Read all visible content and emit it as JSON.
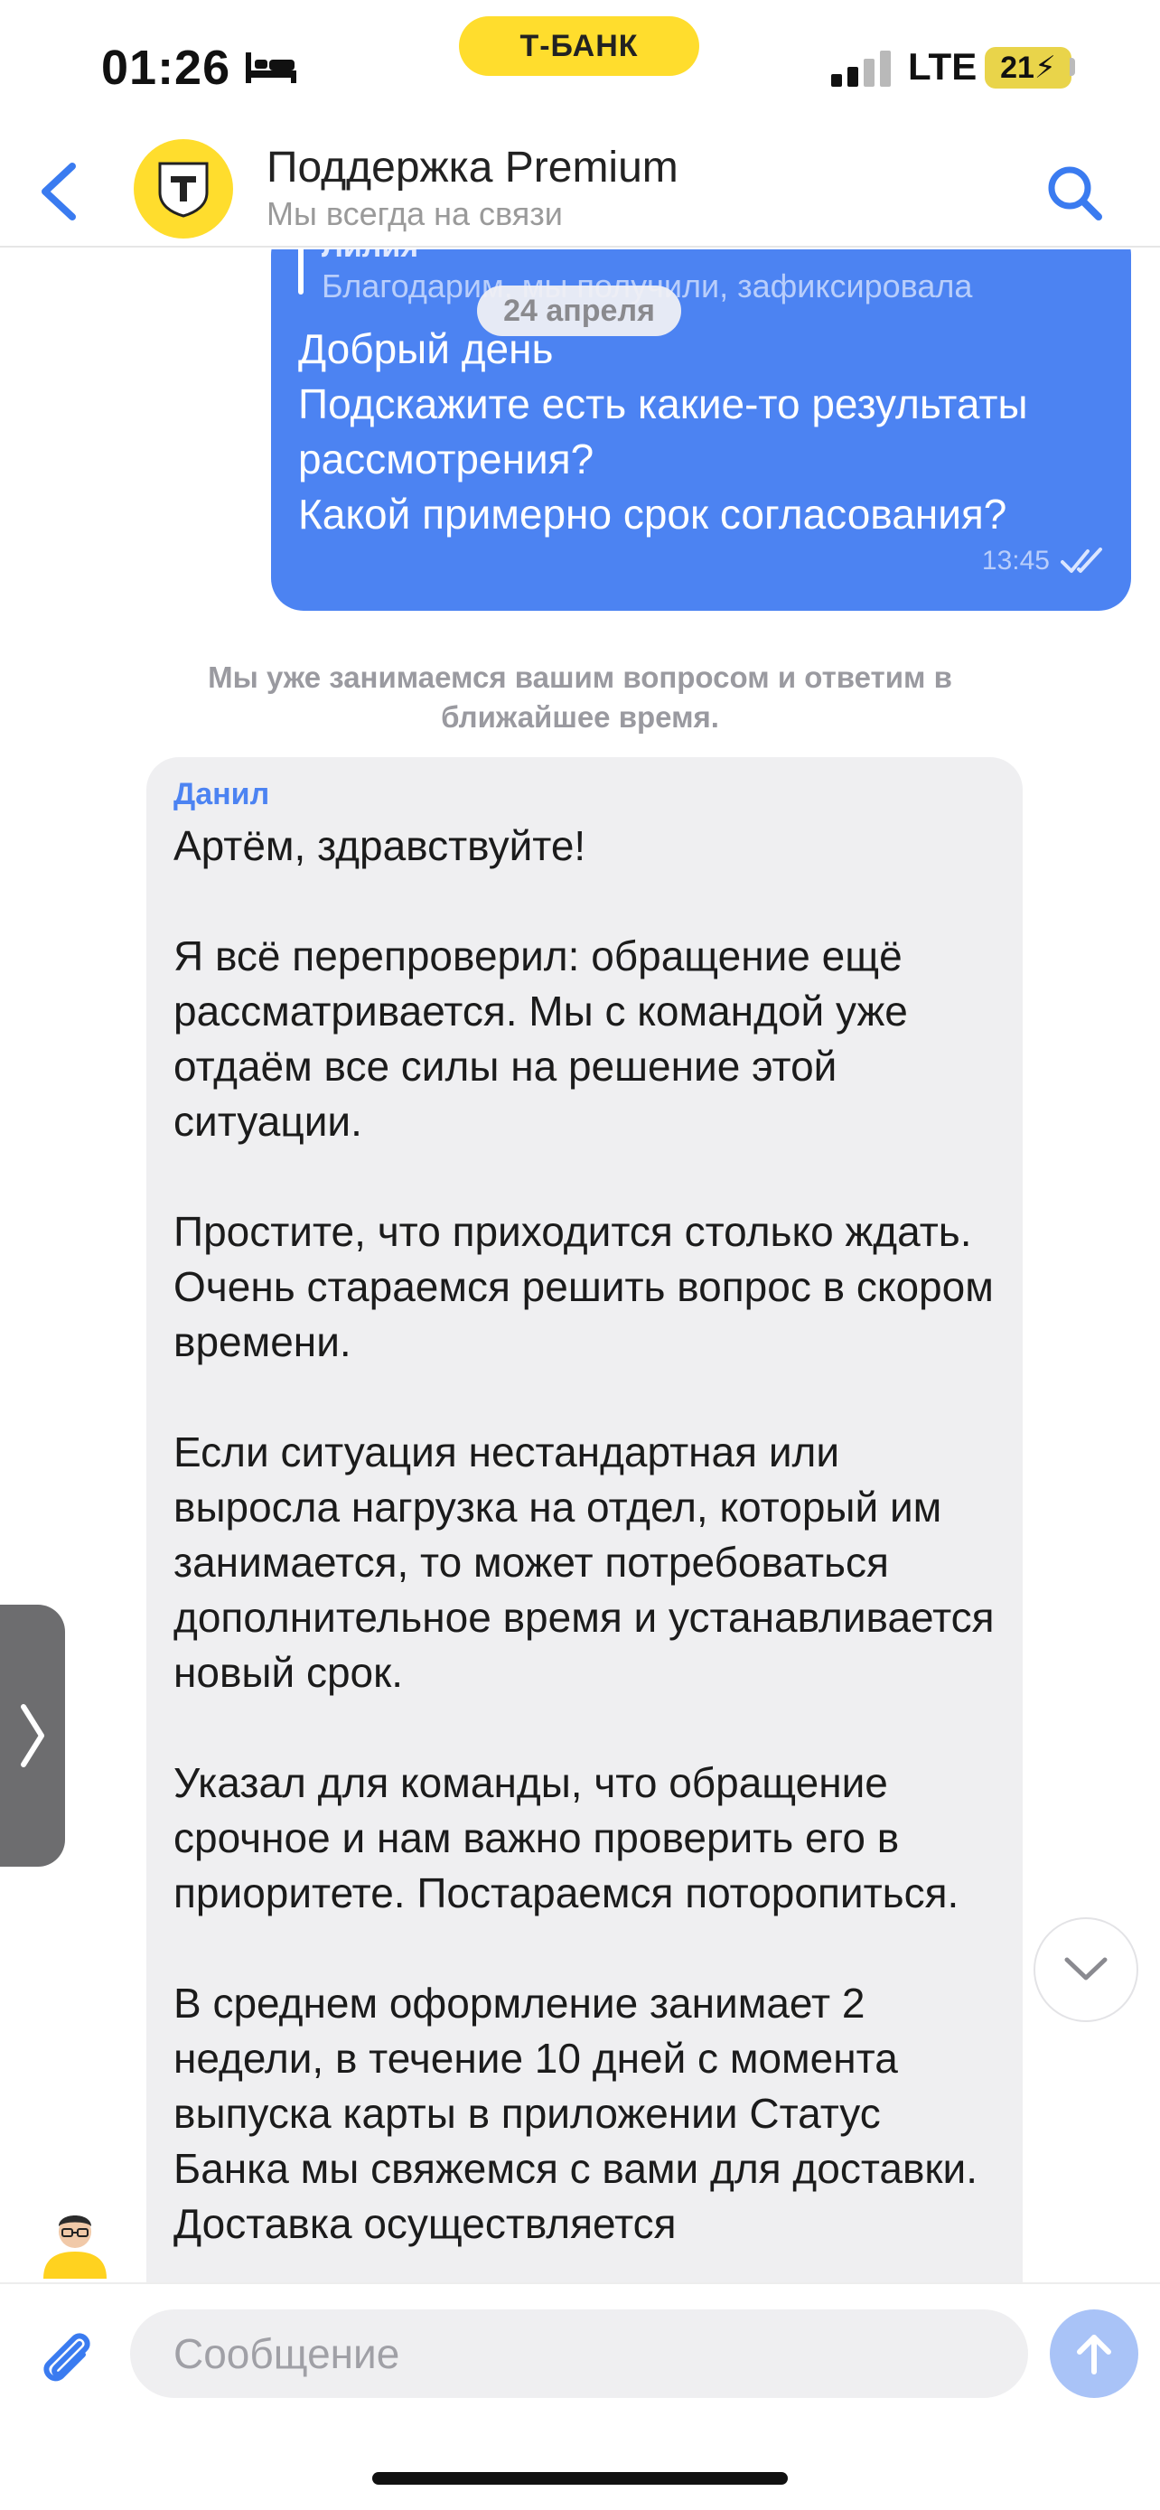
{
  "status_bar": {
    "time": "01:26",
    "carrier_badge": "Т-БАНК",
    "network": "LTE",
    "battery": "21"
  },
  "header": {
    "title": "Поддержка Premium",
    "subtitle": "Мы всегда на связи"
  },
  "chat": {
    "date_separator": "24 апреля",
    "outgoing": {
      "quote_author": "Лилия",
      "quote_text": "Благодарим, мы получили, зафиксировала",
      "text": "Добрый день\nПодскажите есть какие-то результаты рассмотрения?\nКакой примерно срок согласования?",
      "time": "13:45"
    },
    "system_note": "Мы уже занимаемся вашим вопросом и ответим в ближайшее время.",
    "incoming": {
      "sender": "Данил",
      "text": "Артём, здравствуйте!\n\nЯ всё перепроверил: обращение ещё рассматривается. Мы с командой уже отдаём все силы на решение этой ситуации.\n\nПростите, что приходится столько ждать. Очень стараемся решить вопрос в скором времени.\n\nЕсли ситуация нестандартная или выросла нагрузка на отдел, который им занимается, то может потребоваться дополнительное время и устанавливается новый срок.\n\nУказал для команды, что обращение срочное и нам важно проверить его в приоритете. Постараемся поторопиться.\n\nВ среднем оформление занимает 2 недели, в течение 10 дней с момента выпуска карты в приложении Статус Банка мы свяжемся с вами для доставки. Доставка осуществляется"
    }
  },
  "composer": {
    "placeholder": "Сообщение",
    "value": ""
  },
  "colors": {
    "accent": "#4c83f2",
    "brand_yellow": "#ffdd2d",
    "incoming_bubble": "#efeff1"
  },
  "icons": [
    "bed-icon",
    "signal-icon",
    "back-chevron-icon",
    "bank-logo-icon",
    "search-icon",
    "double-check-icon",
    "chevron-right-icon",
    "chevron-down-icon",
    "paperclip-icon",
    "arrow-up-icon"
  ]
}
